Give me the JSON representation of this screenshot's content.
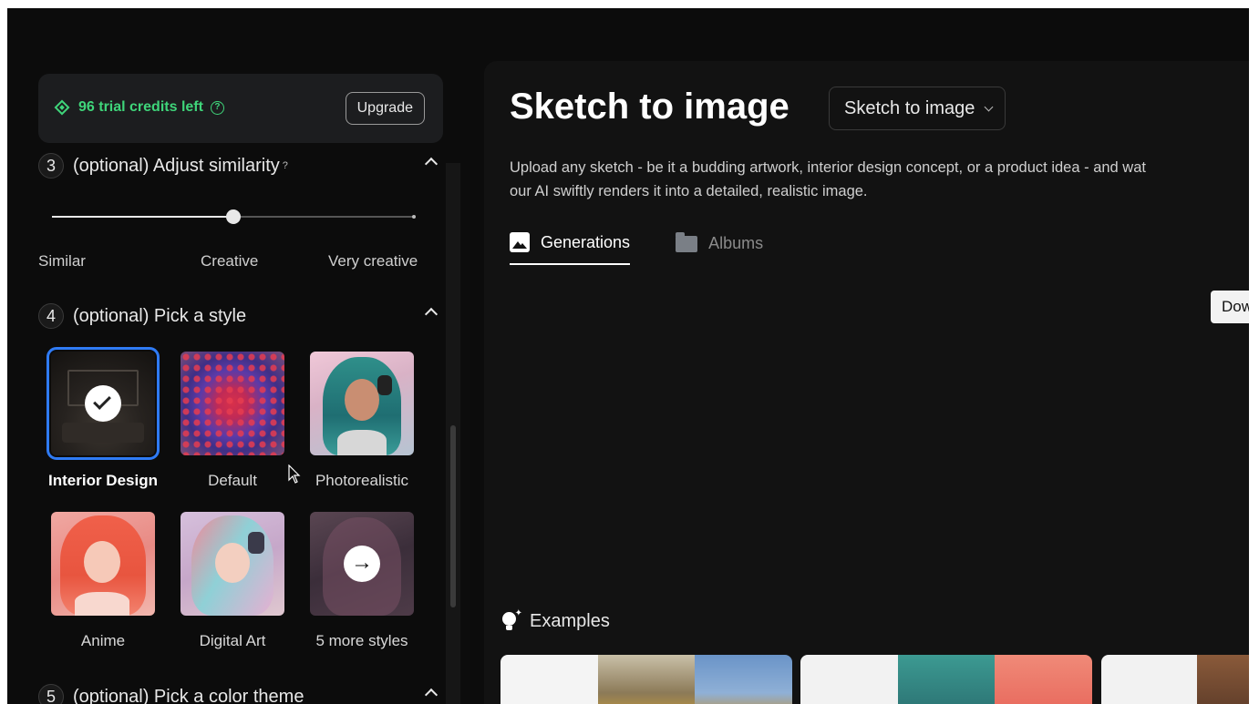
{
  "credits": {
    "text": "96 trial credits left",
    "help_glyph": "?",
    "upgrade_label": "Upgrade"
  },
  "similarity": {
    "number": "3",
    "title": "(optional) Adjust similarity",
    "help_glyph": "?",
    "value_fraction": 0.5,
    "labels": [
      "Similar",
      "Creative",
      "Very creative"
    ]
  },
  "style_section": {
    "number": "4",
    "title": "(optional) Pick a style",
    "styles": [
      {
        "label": "Interior Design",
        "selected": true
      },
      {
        "label": "Default",
        "selected": false
      },
      {
        "label": "Photorealistic",
        "selected": false
      },
      {
        "label": "Anime",
        "selected": false
      },
      {
        "label": "Digital Art",
        "selected": false
      },
      {
        "label": "5 more styles",
        "selected": false
      }
    ]
  },
  "color_section": {
    "number": "5",
    "title": "(optional) Pick a color theme"
  },
  "main": {
    "title": "Sketch to image",
    "mode_select": "Sketch to image",
    "description_line1": "Upload any sketch - be it a budding artwork, interior design concept, or a product idea - and wat",
    "description_line2": "our AI swiftly renders it into a detailed, realistic image.",
    "tabs": [
      {
        "label": "Generations",
        "icon": "image-icon",
        "active": true
      },
      {
        "label": "Albums",
        "icon": "folder-icon",
        "active": false
      }
    ],
    "download_label": "Dow",
    "examples_title": "Examples"
  },
  "colors": {
    "accent_green": "#3fd57a",
    "selection_blue": "#2f7bf5",
    "background": "#0c0c0c",
    "panel": "#121212"
  }
}
